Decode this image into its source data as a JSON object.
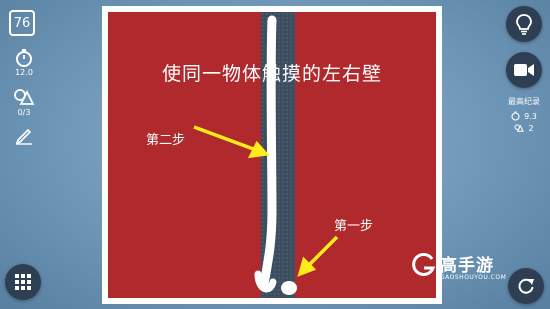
{
  "level": "76",
  "stats": {
    "time": "12.0",
    "shapes": "0/3"
  },
  "puzzle": {
    "instruction": "使同一物体触摸的左右壁"
  },
  "annotations": {
    "step1": "第一步",
    "step2": "第二步"
  },
  "record": {
    "title": "最高纪录",
    "time": "9.3",
    "shapes": "2"
  },
  "watermark": {
    "brand": "高手游",
    "url": "GAOSHOUYOU.COM"
  },
  "colors": {
    "wall_red": "#b02a2d",
    "strip": "#3b4d5e",
    "arrow": "#ffec1a",
    "button": "#2f3f53"
  },
  "icons": [
    "stopwatch-icon",
    "shapes-icon",
    "pencil-icon",
    "grid-menu-icon",
    "lightbulb-icon",
    "video-camera-icon",
    "restart-icon"
  ]
}
